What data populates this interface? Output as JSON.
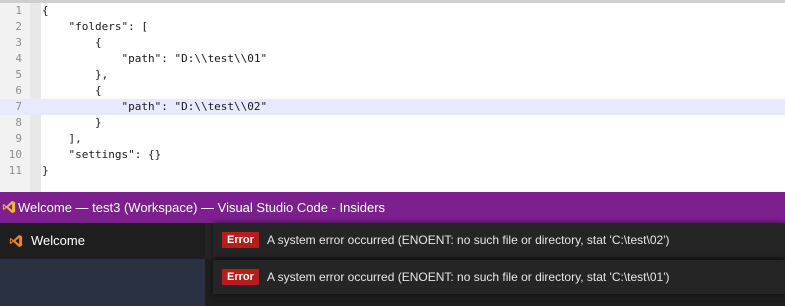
{
  "editor": {
    "lines": [
      {
        "num": "1",
        "text": "{"
      },
      {
        "num": "2",
        "text": "    \"folders\": ["
      },
      {
        "num": "3",
        "text": "        {"
      },
      {
        "num": "4",
        "text": "            \"path\": \"D:\\\\test\\\\01\""
      },
      {
        "num": "5",
        "text": "        },"
      },
      {
        "num": "6",
        "text": "        {"
      },
      {
        "num": "7",
        "text": "            \"path\": \"D:\\\\test\\\\02\""
      },
      {
        "num": "8",
        "text": "        }"
      },
      {
        "num": "9",
        "text": "    ],"
      },
      {
        "num": "10",
        "text": "    \"settings\": {}"
      },
      {
        "num": "11",
        "text": "}"
      }
    ],
    "active_line": "7"
  },
  "window": {
    "title": "Welcome — test3 (Workspace) — Visual Studio Code - Insiders",
    "logo_icon": "vscode-insiders-logo-icon",
    "titlebar_color": "#7e1f8f"
  },
  "tabs": [
    {
      "label": "Welcome",
      "icon": "vscode-insiders-logo-icon"
    }
  ],
  "notifications": [
    {
      "badge": "Error",
      "message": "A system error occurred (ENOENT: no such file or directory, stat 'C:\\test\\02')"
    },
    {
      "badge": "Error",
      "message": "A system error occurred (ENOENT: no such file or directory, stat 'C:\\test\\01')"
    }
  ],
  "colors": {
    "error_badge": "#b91c1c",
    "active_line_bg": "#e8e8ff"
  }
}
